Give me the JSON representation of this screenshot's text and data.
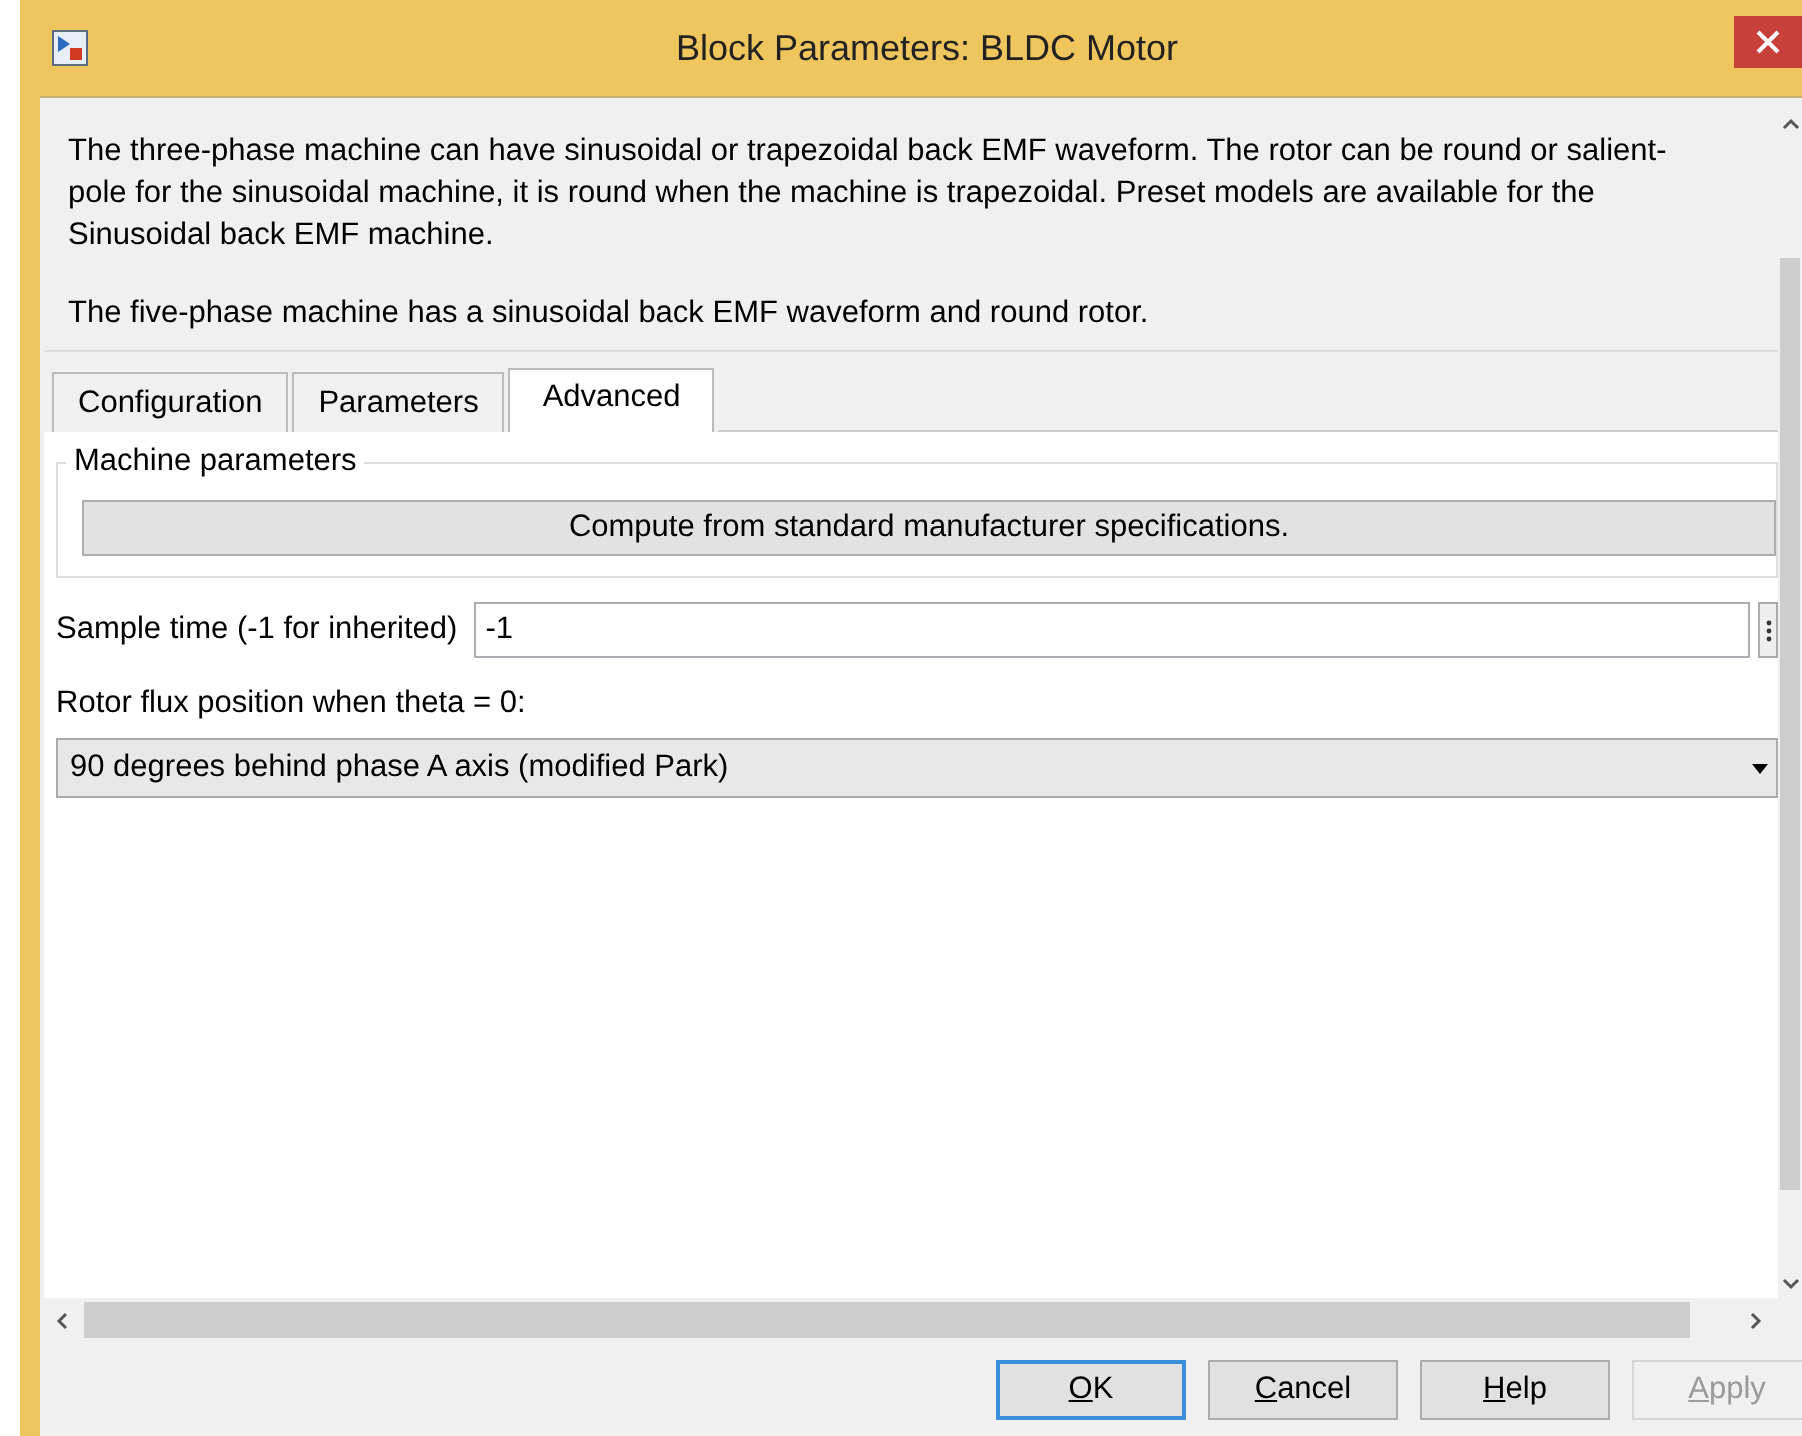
{
  "window": {
    "title": "Block Parameters: BLDC Motor"
  },
  "description": [
    "The three-phase machine can have sinusoidal or trapezoidal back EMF waveform. The rotor can be round or salient-pole for the sinusoidal machine, it is round when the machine is trapezoidal. Preset models are available for the Sinusoidal back EMF machine.",
    "The five-phase machine has a sinusoidal back EMF waveform and round rotor."
  ],
  "tabs": [
    {
      "label": "Configuration",
      "selected": false
    },
    {
      "label": "Parameters",
      "selected": false
    },
    {
      "label": "Advanced",
      "selected": true
    }
  ],
  "group": {
    "title": "Machine parameters",
    "button": "Compute from standard manufacturer specifications."
  },
  "sample_time": {
    "label": "Sample time (-1 for inherited)",
    "value": "-1"
  },
  "rotor_flux": {
    "label": "Rotor flux position when theta = 0:",
    "value": "90 degrees behind phase A axis (modified Park)"
  },
  "buttons": [
    {
      "accelerator": "O",
      "rest": "K",
      "default": true,
      "disabled": false
    },
    {
      "accelerator": "C",
      "rest": "ancel",
      "default": false,
      "disabled": false
    },
    {
      "accelerator": "H",
      "rest": "elp",
      "default": false,
      "disabled": false
    },
    {
      "accelerator": "A",
      "rest": "pply",
      "default": false,
      "disabled": true
    }
  ]
}
